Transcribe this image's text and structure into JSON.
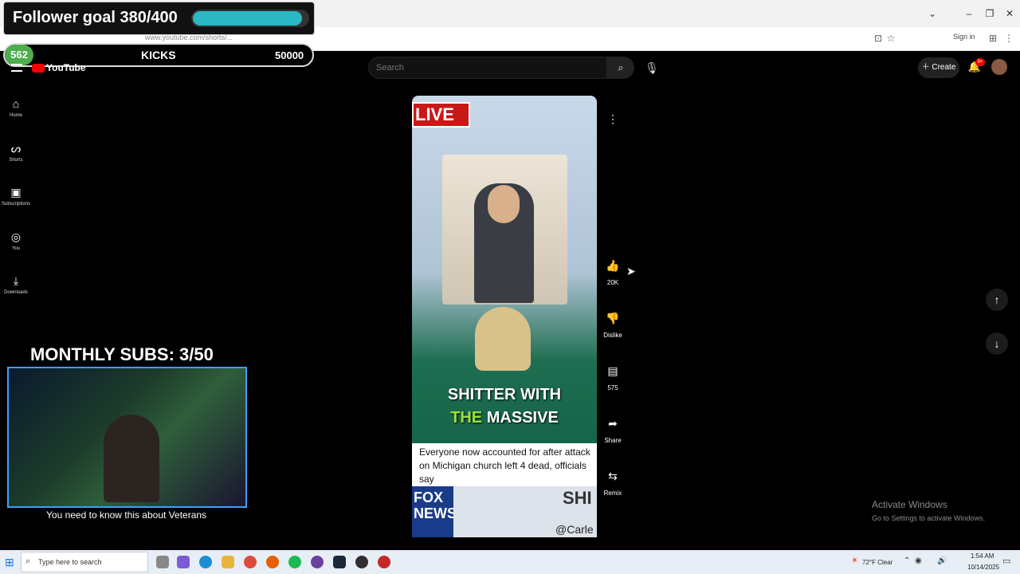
{
  "overlay": {
    "follower_goal": "Follower goal 380/400",
    "follower_progress": 0.95,
    "kicks_badge": "562",
    "kicks_label": "KICKS",
    "kicks_value": "50000",
    "monthly_subs": "MONTHLY SUBS: 3/50",
    "webcam_caption": "You need to know this about Veterans"
  },
  "browser": {
    "url": "www.youtube.com/shorts/...",
    "signin": "Sign in",
    "minimize": "–",
    "maximize": "❐",
    "close": "✕"
  },
  "header": {
    "logo": "YouTube",
    "search_placeholder": "Search",
    "create_label": "Create",
    "notif_badge": "9+"
  },
  "sidebar": {
    "items": [
      {
        "label": "Home",
        "icon": "home-icon"
      },
      {
        "label": "Shorts",
        "icon": "shorts-icon"
      },
      {
        "label": "Subscriptions",
        "icon": "subscriptions-icon"
      },
      {
        "label": "You",
        "icon": "you-icon"
      },
      {
        "label": "Downloads",
        "icon": "download-icon"
      }
    ]
  },
  "video": {
    "live_badge": "LIVE",
    "caption_line1": "SHITTER WITH",
    "caption_line2_highlight": "THE",
    "caption_line2_rest": " MASSIVE",
    "news_headline": "Everyone now accounted for after attack on Michigan church left 4 dead, officials say",
    "fox_logo": "FOX NEWS",
    "ticker": "SHI",
    "handle": "@Carle"
  },
  "actions": {
    "like_count": "20K",
    "dislike_label": "Dislike",
    "comment_count": "575",
    "share_label": "Share",
    "remix_label": "Remix"
  },
  "watermark": {
    "title": "Activate Windows",
    "subtitle": "Go to Settings to activate Windows."
  },
  "taskbar": {
    "search_placeholder": "Type here to search",
    "weather": "72°F  Clear",
    "time": "1:54 AM",
    "date": "10/14/2025"
  }
}
